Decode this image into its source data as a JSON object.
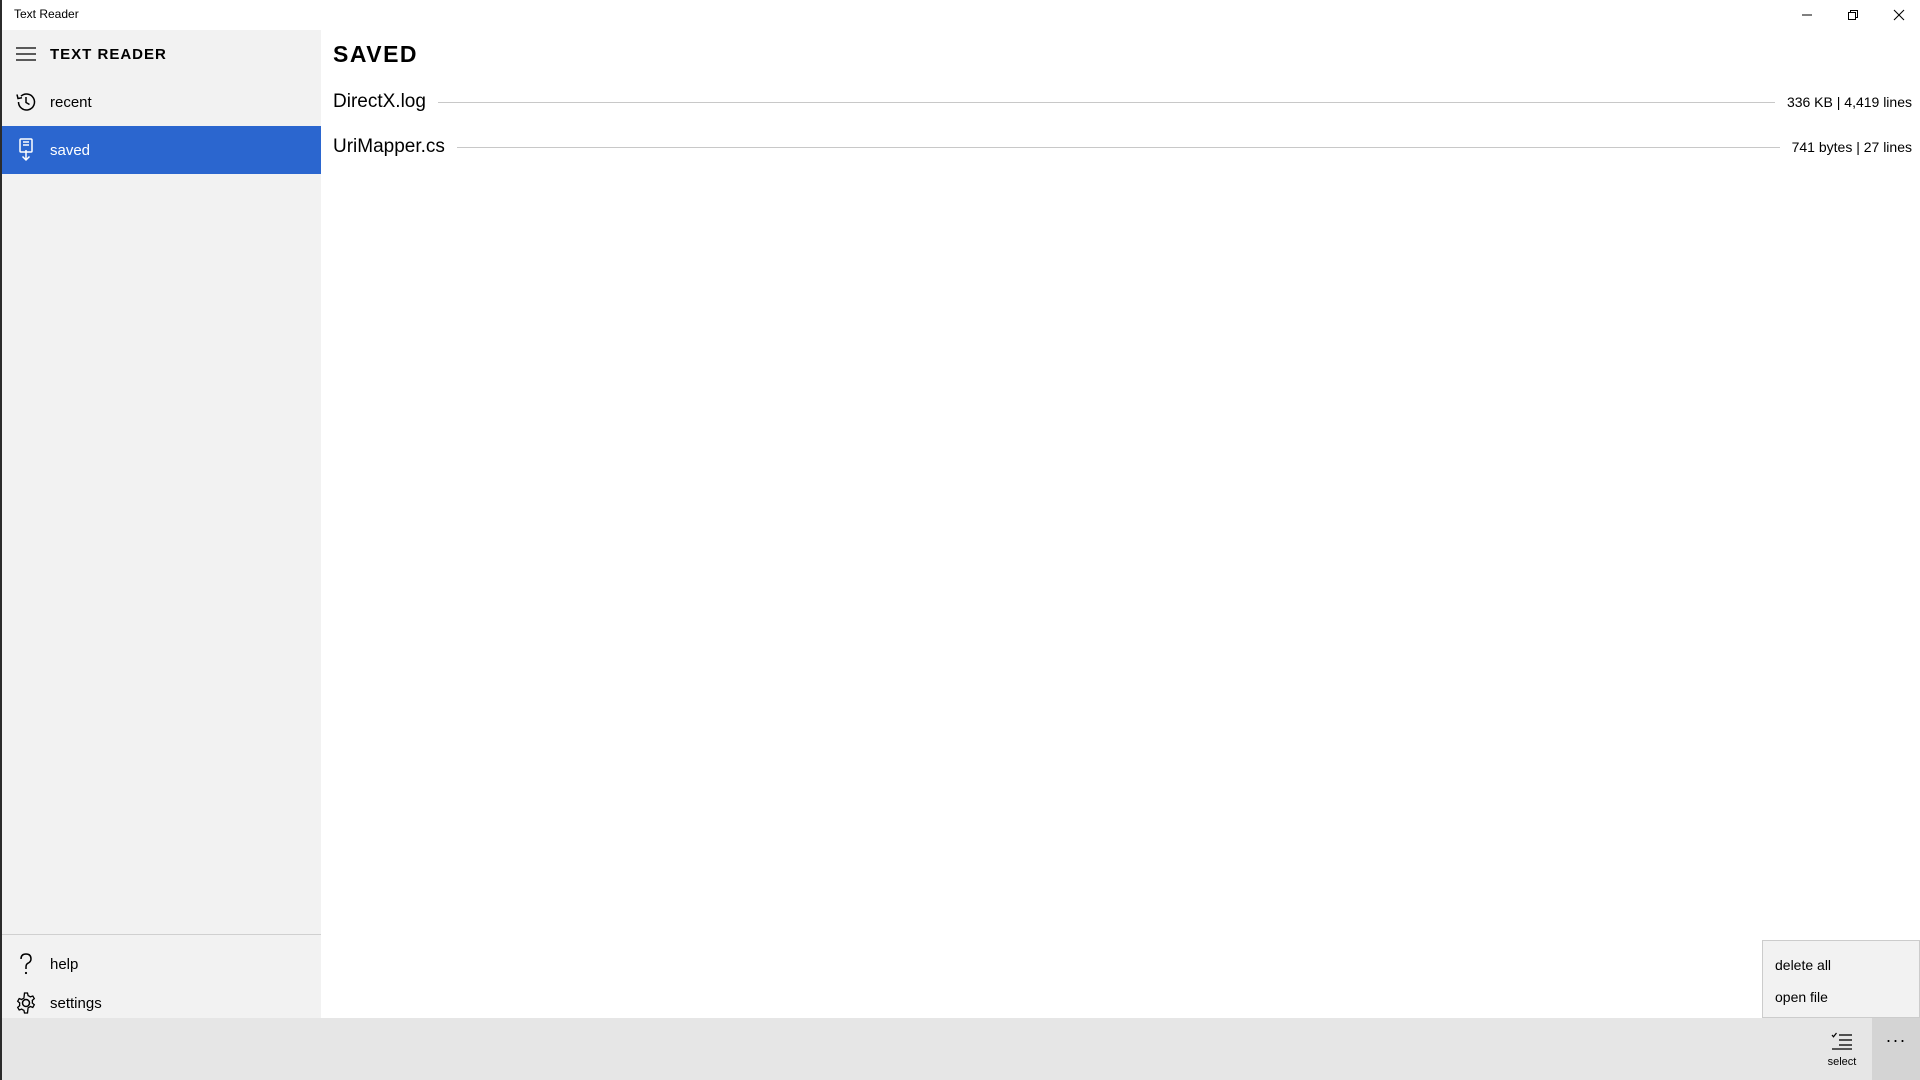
{
  "window": {
    "title": "Text Reader"
  },
  "sidebar": {
    "app_name": "TEXT READER",
    "items": [
      {
        "label": "recent",
        "icon": "history-icon",
        "selected": false
      },
      {
        "label": "saved",
        "icon": "saved-download-icon",
        "selected": true
      }
    ],
    "footer_items": [
      {
        "label": "help",
        "icon": "help-icon"
      },
      {
        "label": "settings",
        "icon": "gear-icon"
      }
    ]
  },
  "main": {
    "title": "SAVED",
    "files": [
      {
        "name": "DirectX.log",
        "meta": "336 KB | 4,419 lines"
      },
      {
        "name": "UriMapper.cs",
        "meta": "741 bytes | 27 lines"
      }
    ]
  },
  "command_bar": {
    "select_label": "select",
    "more_label": "···"
  },
  "overflow_menu": {
    "items": [
      "delete all",
      "open file"
    ]
  },
  "colors": {
    "accent": "#2b66cf",
    "sidebar_bg": "#f2f2f2",
    "command_bar_bg": "#e6e6e6"
  }
}
